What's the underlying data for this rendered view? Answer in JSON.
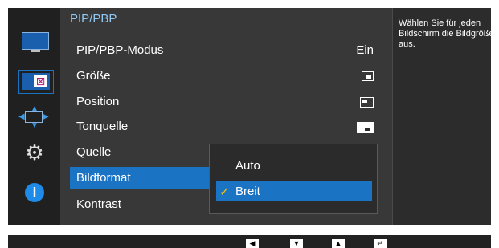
{
  "menu": {
    "title": "PIP/PBP",
    "items": [
      {
        "label": "PIP/PBP-Modus",
        "value": "Ein"
      },
      {
        "label": "Größe"
      },
      {
        "label": "Position"
      },
      {
        "label": "Tonquelle"
      },
      {
        "label": "Quelle"
      },
      {
        "label": "Bildformat"
      },
      {
        "label": "Kontrast"
      }
    ],
    "selected_index": 5
  },
  "dropdown": {
    "options": [
      "Auto",
      "Breit"
    ],
    "selected": "Breit",
    "check_glyph": "✓"
  },
  "help": {
    "text": "Wählen Sie für jeden Bildschirm die Bildgröße aus."
  },
  "sidebar_icons": [
    "monitor-icon",
    "pip-icon",
    "arrows-icon",
    "gear-icon",
    "info-icon"
  ],
  "nav_buttons": [
    {
      "name": "left-arrow-icon",
      "glyph": "◀"
    },
    {
      "name": "down-arrow-icon",
      "glyph": "▼"
    },
    {
      "name": "up-arrow-icon",
      "glyph": "▲"
    },
    {
      "name": "enter-icon",
      "glyph": "↵"
    }
  ],
  "colors": {
    "accent": "#1b73c4",
    "title": "#8fc8f2",
    "check": "#f4c20d",
    "panel": "#2c2c2c"
  },
  "info_glyph": "i",
  "gear_glyph": "⚙",
  "pip_mark": "⊠"
}
